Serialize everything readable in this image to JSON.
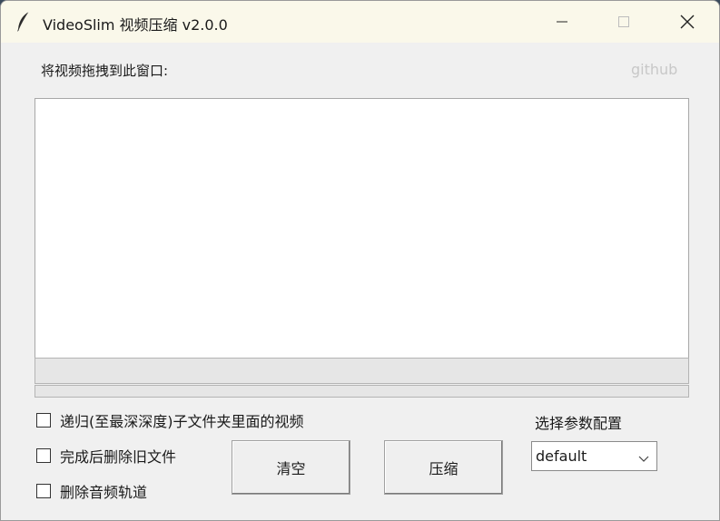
{
  "window": {
    "title": "VideoSlim 视频压缩 v2.0.0",
    "icon": "feather-icon",
    "controls": [
      "minimize-icon",
      "maximize-icon",
      "close-icon"
    ]
  },
  "main": {
    "drop_label": "将视频拖拽到此窗口:",
    "github_link": "github",
    "progress": 0
  },
  "options": {
    "recursive": {
      "label": "递归(至最深深度)子文件夹里面的视频",
      "checked": false
    },
    "delete_source": {
      "label": "完成后删除旧文件",
      "checked": false
    },
    "remove_audio": {
      "label": "删除音频轨道",
      "checked": false
    }
  },
  "buttons": {
    "clear_label": "清空",
    "compress_label": "压缩"
  },
  "preset": {
    "label": "选择参数配置",
    "selected": "default"
  },
  "colors": {
    "titlebar": "#faf8ea",
    "window_bg": "#f0f0f0",
    "github_link": "#c8c8c8"
  }
}
